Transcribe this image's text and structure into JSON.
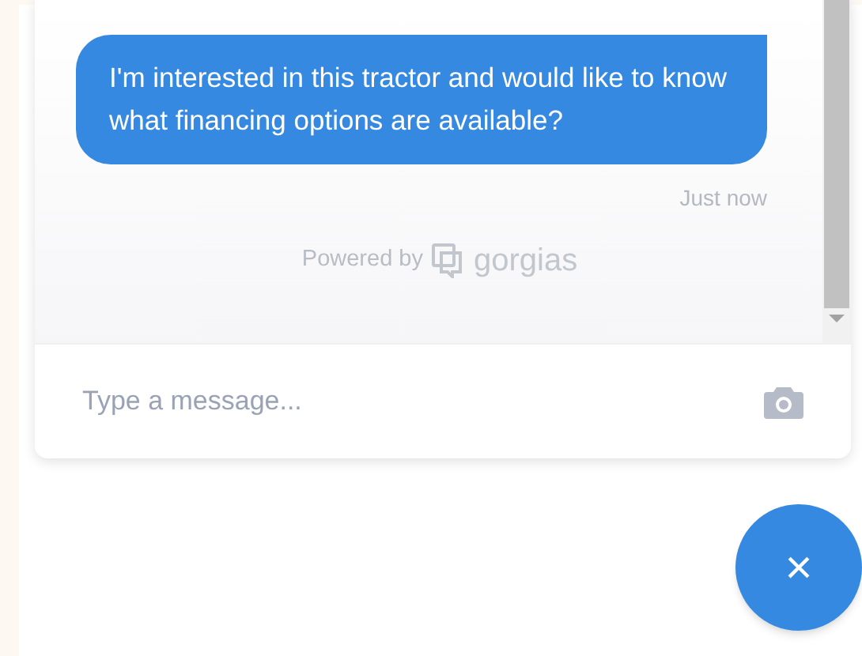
{
  "messages": [
    {
      "text": "I'm interested in this tractor and would like to know what financing options are available?",
      "time": "Just now"
    }
  ],
  "powered_by": {
    "label": "Powered by",
    "brand": "gorgias"
  },
  "composer": {
    "placeholder": "Type a message..."
  },
  "launcher": {
    "label": "×",
    "expanded": true
  }
}
